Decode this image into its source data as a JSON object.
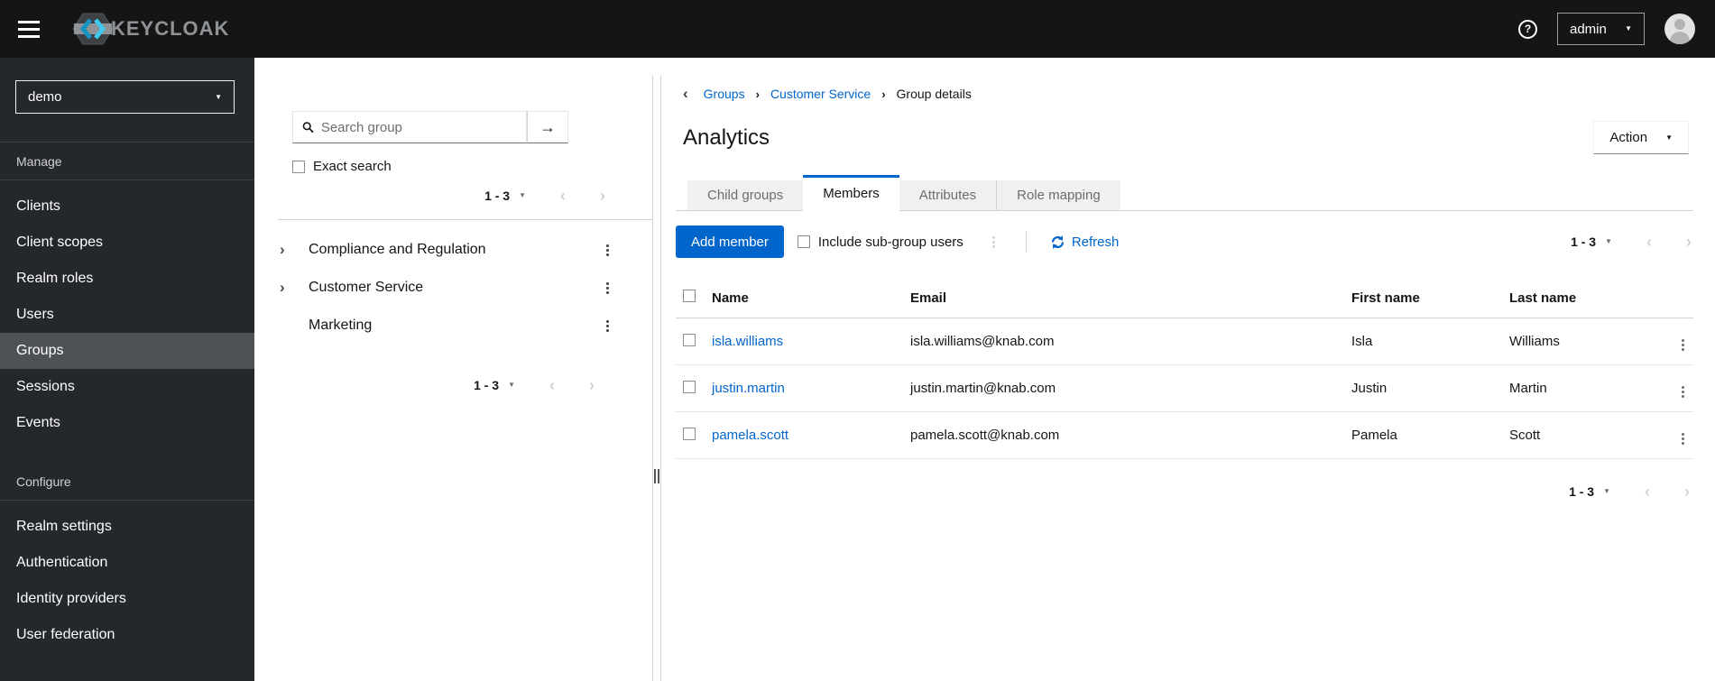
{
  "masthead": {
    "brand": "KEYCLOAK",
    "user": "admin"
  },
  "icons": {
    "question": "?",
    "caret_down": "▼",
    "chevron_left": "‹",
    "chevron_right": "›",
    "arrow_right": "→",
    "back_chevron": "‹",
    "breadcrumb_separator": "›"
  },
  "sidebar": {
    "realm": "demo",
    "sections": [
      {
        "label": "Manage",
        "items": [
          {
            "label": "Clients",
            "selected": false
          },
          {
            "label": "Client scopes",
            "selected": false
          },
          {
            "label": "Realm roles",
            "selected": false
          },
          {
            "label": "Users",
            "selected": false
          },
          {
            "label": "Groups",
            "selected": true
          },
          {
            "label": "Sessions",
            "selected": false
          },
          {
            "label": "Events",
            "selected": false
          }
        ]
      },
      {
        "label": "Configure",
        "items": [
          {
            "label": "Realm settings",
            "selected": false
          },
          {
            "label": "Authentication",
            "selected": false
          },
          {
            "label": "Identity providers",
            "selected": false
          },
          {
            "label": "User federation",
            "selected": false
          }
        ]
      }
    ]
  },
  "group_panel": {
    "search_placeholder": "Search group",
    "exact_search_label": "Exact search",
    "pagination_top": {
      "range": "1 - 3"
    },
    "tree": [
      {
        "label": "Compliance and Regulation",
        "expandable": true
      },
      {
        "label": "Customer Service",
        "expandable": true
      },
      {
        "label": "Marketing",
        "expandable": false
      }
    ],
    "pagination_bottom": {
      "range": "1 - 3"
    }
  },
  "main": {
    "breadcrumb": {
      "items": [
        "Groups",
        "Customer Service",
        "Group details"
      ]
    },
    "title": "Analytics",
    "action_label": "Action",
    "tabs": [
      {
        "label": "Child groups",
        "active": false
      },
      {
        "label": "Members",
        "active": true
      },
      {
        "label": "Attributes",
        "active": false
      },
      {
        "label": "Role mapping",
        "active": false
      }
    ],
    "toolbar": {
      "add_member_label": "Add member",
      "include_subgroups_label": "Include sub-group users",
      "refresh_label": "Refresh",
      "pagination": {
        "range": "1 - 3"
      }
    },
    "table": {
      "columns": [
        "Name",
        "Email",
        "First name",
        "Last name"
      ],
      "rows": [
        {
          "name": "isla.williams",
          "email": "isla.williams@knab.com",
          "first_name": "Isla",
          "last_name": "Williams"
        },
        {
          "name": "justin.martin",
          "email": "justin.martin@knab.com",
          "first_name": "Justin",
          "last_name": "Martin"
        },
        {
          "name": "pamela.scott",
          "email": "pamela.scott@knab.com",
          "first_name": "Pamela",
          "last_name": "Scott"
        }
      ]
    },
    "pagination_bottom": {
      "range": "1 - 3"
    }
  },
  "colors": {
    "primary": "#0066cc",
    "link": "#0066cc",
    "masthead_bg": "#151515",
    "sidebar_bg": "#24272b",
    "nav_selected_bg": "#4f5255",
    "tab_inactive_bg": "#f0f0f0",
    "border": "#d2d2d2",
    "logo_cyan": "#2bb8e8"
  }
}
